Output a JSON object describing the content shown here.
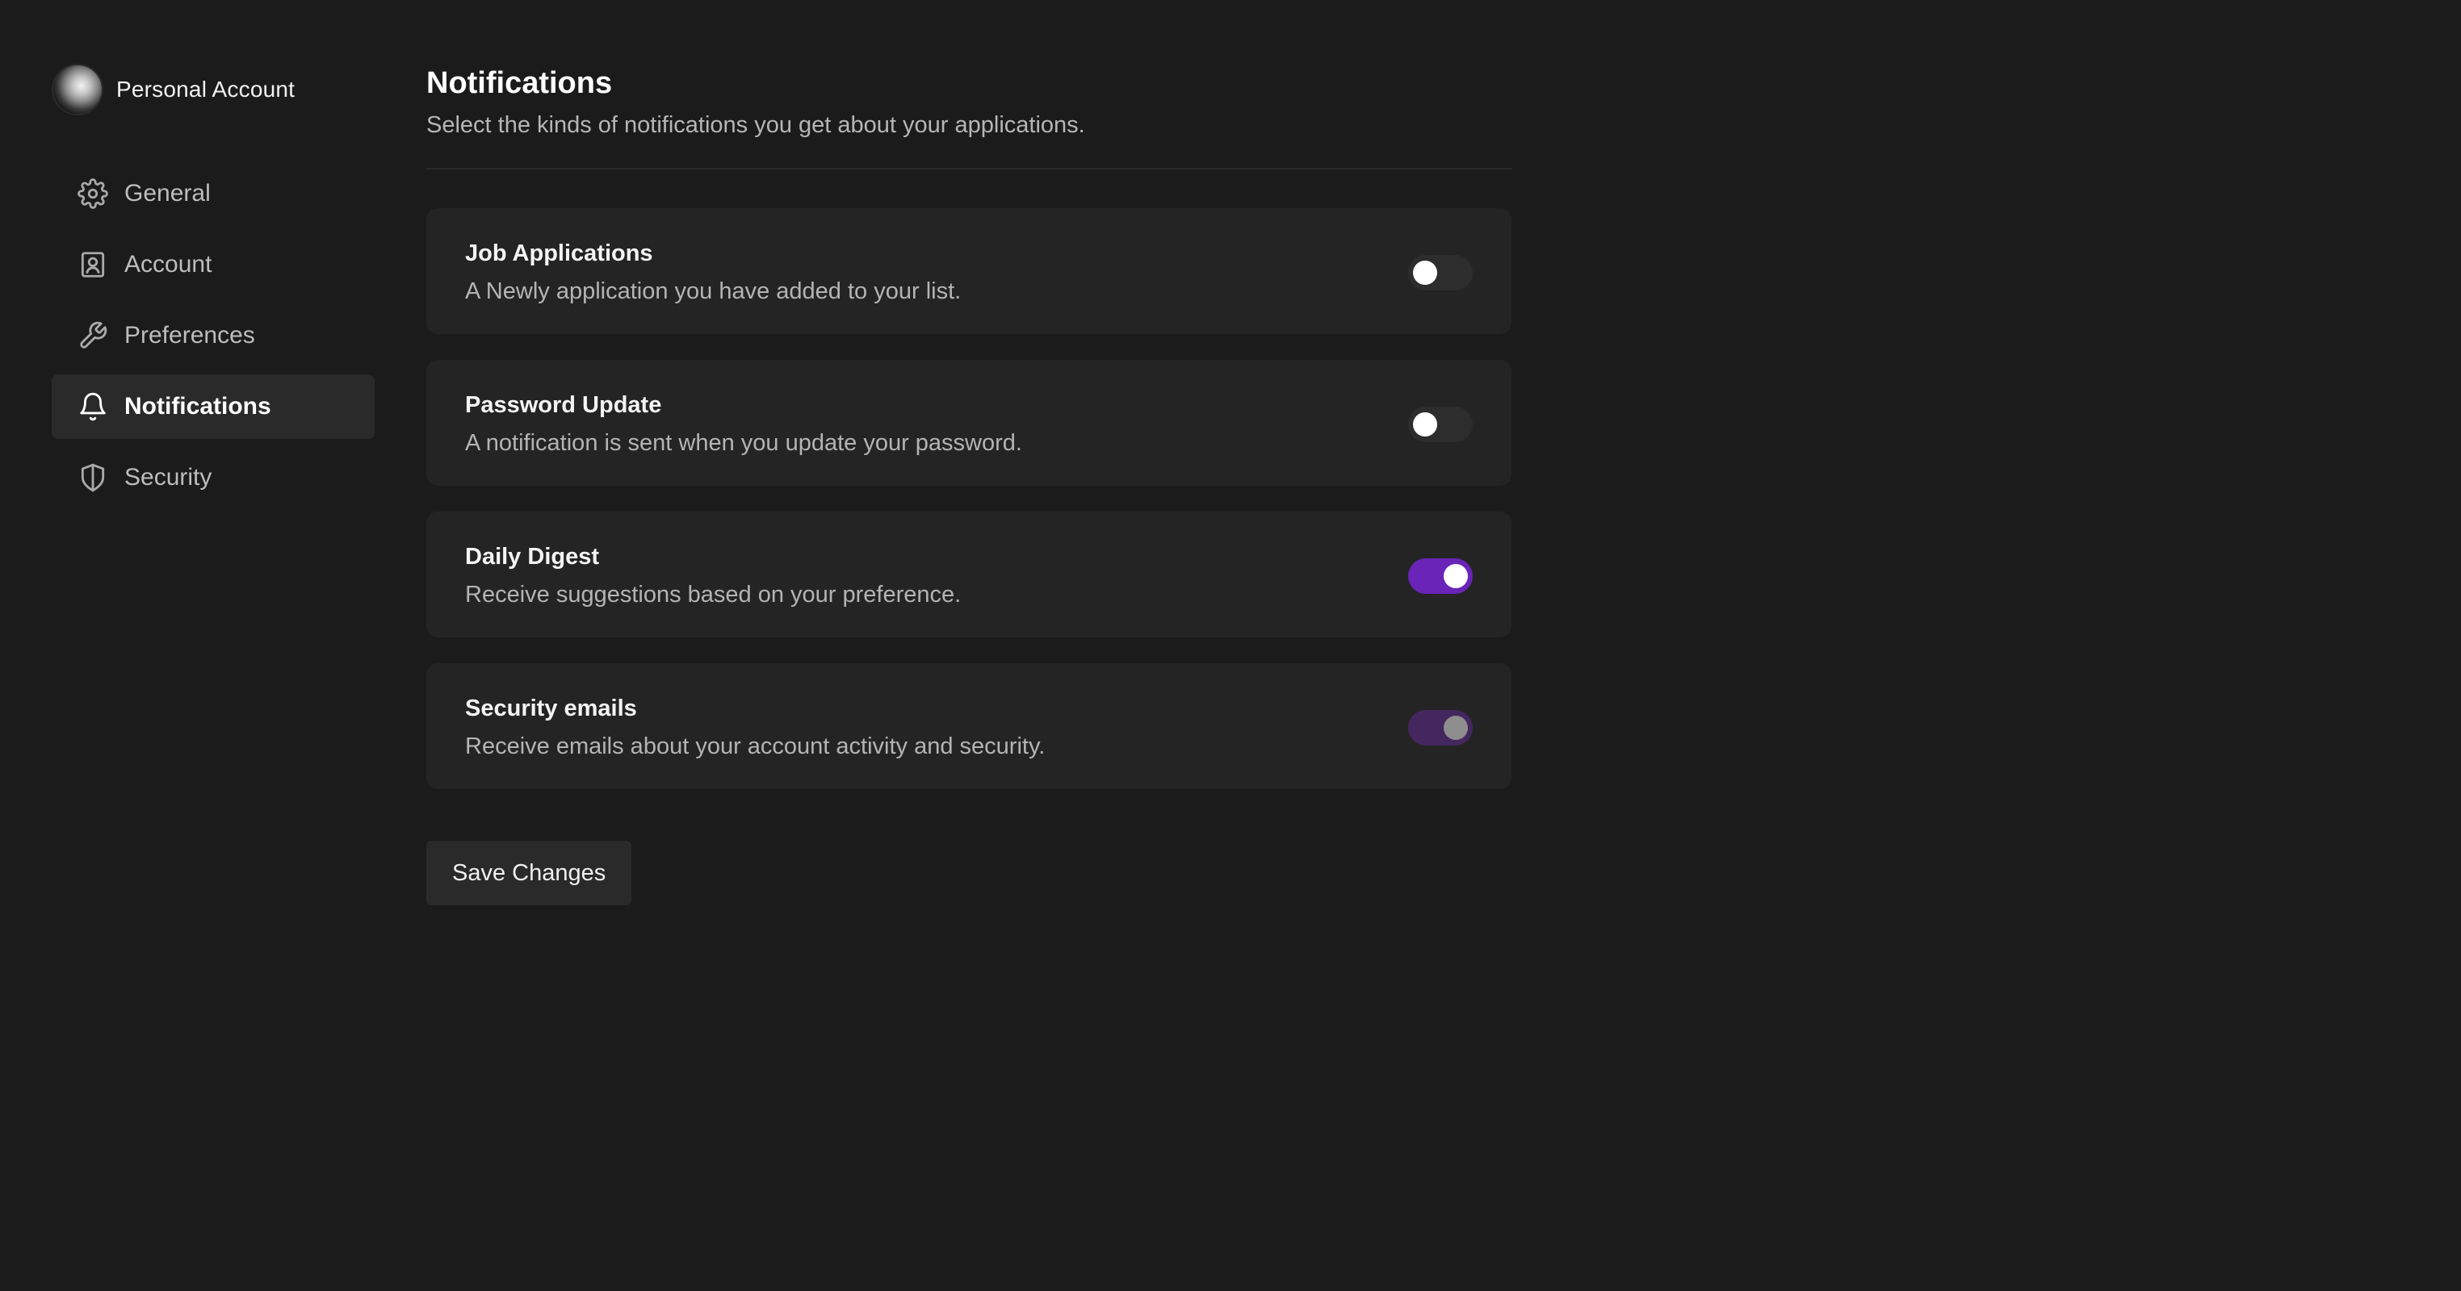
{
  "account": {
    "name": "Personal Account"
  },
  "nav": {
    "items": [
      {
        "label": "General",
        "icon": "gear-icon",
        "active": false
      },
      {
        "label": "Account",
        "icon": "user-card-icon",
        "active": false
      },
      {
        "label": "Preferences",
        "icon": "wrench-icon",
        "active": false
      },
      {
        "label": "Notifications",
        "icon": "bell-icon",
        "active": true
      },
      {
        "label": "Security",
        "icon": "shield-icon",
        "active": false
      }
    ]
  },
  "page": {
    "title": "Notifications",
    "subtitle": "Select the kinds of notifications you get about your applications."
  },
  "settings": [
    {
      "title": "Job Applications",
      "description": "A Newly application you have added to your list.",
      "enabled": false,
      "disabled": false
    },
    {
      "title": "Password Update",
      "description": "A notification is sent when you update your password.",
      "enabled": false,
      "disabled": false
    },
    {
      "title": "Daily Digest",
      "description": "Receive suggestions based on your preference.",
      "enabled": true,
      "disabled": false
    },
    {
      "title": "Security emails",
      "description": "Receive emails about your account activity and security.",
      "enabled": true,
      "disabled": true
    }
  ],
  "actions": {
    "save_label": "Save Changes"
  },
  "colors": {
    "accent": "#6a24b8",
    "accent_disabled": "#45275f",
    "background": "#1b1b1c",
    "card": "#242425"
  }
}
